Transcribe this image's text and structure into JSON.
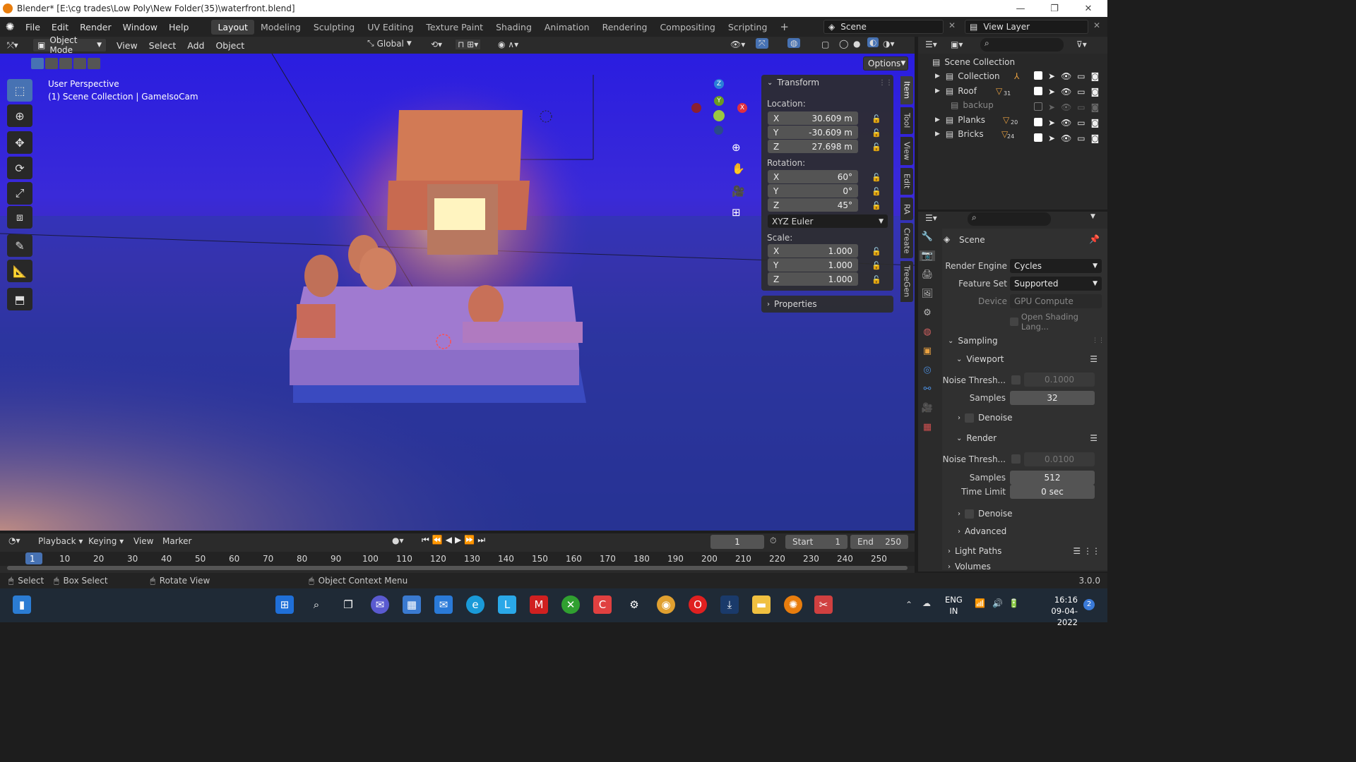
{
  "window": {
    "title": "Blender* [E:\\cg trades\\Low Poly\\New Folder(35)\\waterfront.blend]"
  },
  "menus": [
    "File",
    "Edit",
    "Render",
    "Window",
    "Help"
  ],
  "workspaces": [
    "Layout",
    "Modeling",
    "Sculpting",
    "UV Editing",
    "Texture Paint",
    "Shading",
    "Animation",
    "Rendering",
    "Compositing",
    "Scripting"
  ],
  "scene_field": "Scene",
  "view_layer_field": "View Layer",
  "viewport_header": {
    "mode": "Object Mode",
    "menus": [
      "View",
      "Select",
      "Add",
      "Object"
    ],
    "orientation": "Global",
    "options": "Options"
  },
  "viewport": {
    "line1": "User Perspective",
    "line2": "(1) Scene Collection | GameIsoCam"
  },
  "gizmo": {
    "x": "X",
    "y": "Y",
    "z": "Z"
  },
  "npanel": {
    "transform": "Transform",
    "location_label": "Location:",
    "location": {
      "x": "30.609 m",
      "y": "-30.609 m",
      "z": "27.698 m"
    },
    "rotation_label": "Rotation:",
    "rotation": {
      "x": "60°",
      "y": "0°",
      "z": "45°"
    },
    "rotation_mode": "XYZ Euler",
    "scale_label": "Scale:",
    "scale": {
      "x": "1.000",
      "y": "1.000",
      "z": "1.000"
    },
    "properties": "Properties",
    "axis": {
      "x": "X",
      "y": "Y",
      "z": "Z"
    }
  },
  "side_tabs": [
    "Item",
    "Tool",
    "View",
    "Edit",
    "RA",
    "Create",
    "TreeGen"
  ],
  "outliner": {
    "root": "Scene Collection",
    "items": [
      {
        "name": "Collection",
        "badge": ""
      },
      {
        "name": "Roof",
        "badge": "31"
      },
      {
        "name": "backup",
        "badge": ""
      },
      {
        "name": "Planks",
        "badge": "20"
      },
      {
        "name": "Bricks",
        "badge": "24"
      }
    ]
  },
  "properties": {
    "scene_title": "Scene",
    "render_engine_label": "Render Engine",
    "render_engine": "Cycles",
    "feature_set_label": "Feature Set",
    "feature_set": "Supported",
    "device_label": "Device",
    "device": "GPU Compute",
    "open_shading": "Open Shading Lang...",
    "sampling": "Sampling",
    "viewport": "Viewport",
    "noise_label": "Noise Thresh...",
    "viewport_noise": "0.1000",
    "samples_label": "Samples",
    "viewport_samples": "32",
    "denoise": "Denoise",
    "render": "Render",
    "render_noise": "0.0100",
    "render_samples": "512",
    "time_limit_label": "Time Limit",
    "time_limit": "0 sec",
    "advanced": "Advanced",
    "light_paths": "Light Paths",
    "volumes": "Volumes"
  },
  "timeline": {
    "menus": [
      "Playback",
      "Keying",
      "View",
      "Marker"
    ],
    "current_frame": "1",
    "start_label": "Start",
    "start": "1",
    "end_label": "End",
    "end": "250",
    "ruler": [
      "1",
      "10",
      "20",
      "30",
      "40",
      "50",
      "60",
      "70",
      "80",
      "90",
      "100",
      "110",
      "120",
      "130",
      "140",
      "150",
      "160",
      "170",
      "180",
      "190",
      "200",
      "210",
      "220",
      "230",
      "240",
      "250"
    ]
  },
  "statusbar": {
    "select": "Select",
    "box_select": "Box Select",
    "rotate": "Rotate View",
    "context": "Object Context Menu",
    "version": "3.0.0"
  },
  "taskbar": {
    "lang1": "ENG",
    "lang2": "IN",
    "time": "16:16",
    "date": "09-04-2022",
    "notif": "2"
  }
}
